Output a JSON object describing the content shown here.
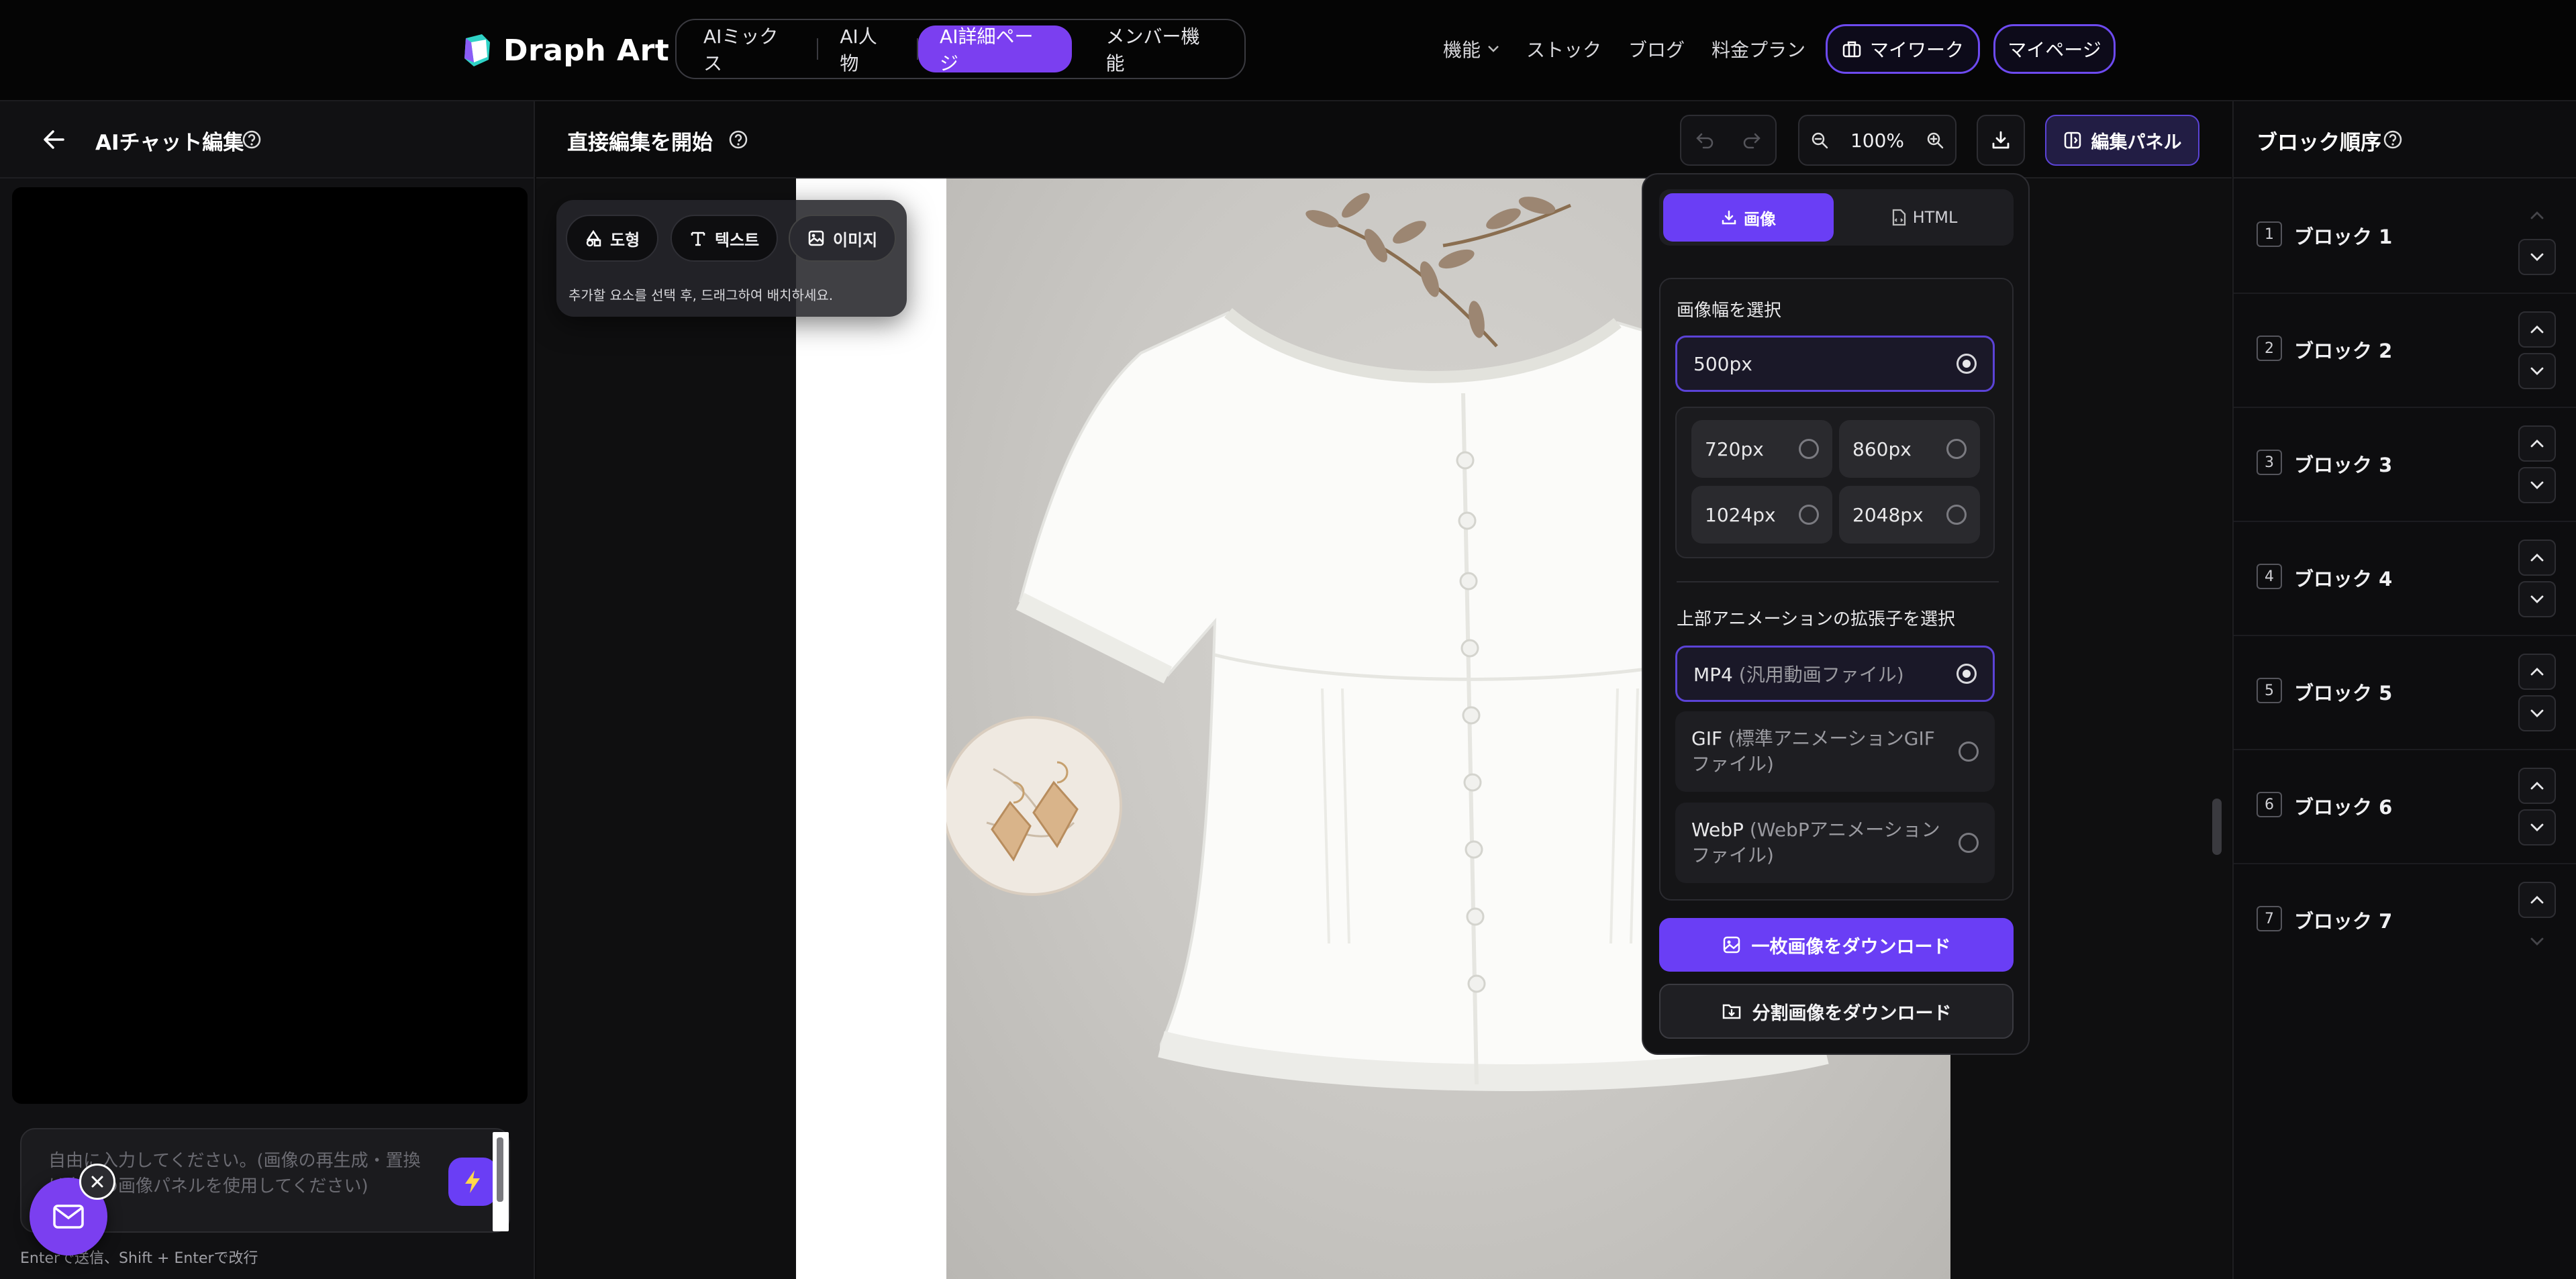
{
  "app": {
    "brand": "Draph Art",
    "accent": "#7b3ff0",
    "nav": {
      "tabs": [
        {
          "label": "AIミックス"
        },
        {
          "label": "AI人物"
        },
        {
          "label": "AI詳細ページ",
          "active": true
        },
        {
          "label": "メンバー機能"
        }
      ],
      "links": [
        "機能",
        "ストック",
        "ブログ",
        "料金プラン"
      ],
      "mywork_label": "マイワーク",
      "mypage_label": "マイページ"
    }
  },
  "left_panel": {
    "title": "AIチャット編集",
    "input_placeholder": "自由に入力してください。(画像の再生成・置換は右側の画像パネルを使用してください)",
    "hint": "Enterで送信、Shift + Enterで改行"
  },
  "editor": {
    "title": "直接編集を開始",
    "zoom": "100%",
    "edit_panel_label": "編集パネル",
    "tools": {
      "shape": "도형",
      "text": "텍스트",
      "image": "이미지",
      "hint": "추가할 요소를 선택 후, 드래그하여 배치하세요."
    }
  },
  "download_panel": {
    "tabs": {
      "image": "画像",
      "html": "HTML"
    },
    "width_label": "画像幅を選択",
    "widths": [
      {
        "label": "500px",
        "selected": true
      },
      {
        "label": "720px",
        "selected": false
      },
      {
        "label": "860px",
        "selected": false
      },
      {
        "label": "1024px",
        "selected": false
      },
      {
        "label": "2048px",
        "selected": false
      }
    ],
    "ext_label": "上部アニメーションの拡張子を選択",
    "formats": [
      {
        "name": "MP4",
        "desc": "(汎用動画ファイル)",
        "selected": true
      },
      {
        "name": "GIF",
        "desc": "(標準アニメーションGIFファイル)",
        "selected": false
      },
      {
        "name": "WebP",
        "desc": "(WebPアニメーションファイル)",
        "selected": false
      }
    ],
    "download_single": "一枚画像をダウンロード",
    "download_split": "分割画像をダウンロード"
  },
  "block_order": {
    "title": "ブロック順序",
    "blocks": [
      {
        "num": "1",
        "label": "ブロック 1"
      },
      {
        "num": "2",
        "label": "ブロック 2"
      },
      {
        "num": "3",
        "label": "ブロック 3"
      },
      {
        "num": "4",
        "label": "ブロック 4"
      },
      {
        "num": "5",
        "label": "ブロック 5"
      },
      {
        "num": "6",
        "label": "ブロック 6"
      },
      {
        "num": "7",
        "label": "ブロック 7"
      }
    ]
  }
}
